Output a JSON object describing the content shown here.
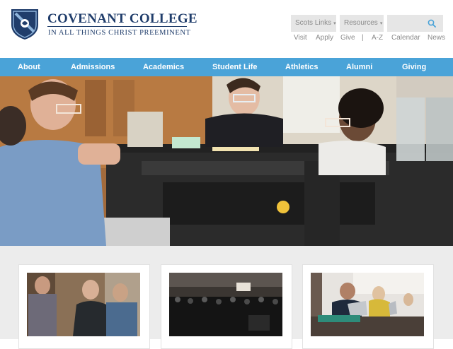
{
  "logo": {
    "name": "COVENANT COLLEGE",
    "tagline": "IN ALL THINGS CHRIST PREEMINENT"
  },
  "header": {
    "dropdowns": [
      {
        "label": "Scots Links"
      },
      {
        "label": "Resources"
      }
    ],
    "search_placeholder": "",
    "utility_links": [
      "Visit",
      "Apply",
      "Give",
      "|",
      "A-Z",
      "Calendar",
      "News"
    ]
  },
  "nav": {
    "items": [
      "About",
      "Admissions",
      "Academics",
      "Student Life",
      "Athletics",
      "Alumni",
      "Giving"
    ]
  },
  "colors": {
    "navy": "#203d6b",
    "nav_blue": "#4aa3d8",
    "search_icon": "#4aa3d8",
    "utility_gray": "#8a8a8a"
  },
  "icons": {
    "search": "search-icon",
    "dropdown": "chevron-down-icon",
    "shield": "shield-logo"
  }
}
